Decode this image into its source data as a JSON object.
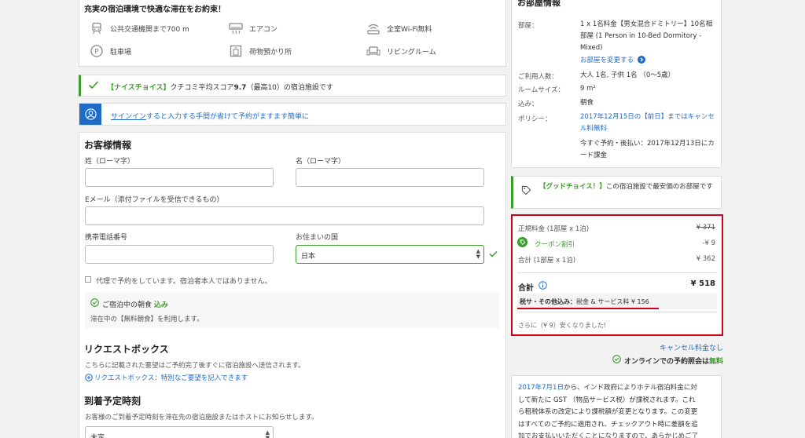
{
  "amenities": {
    "heading": "充実の宿泊環境で快適な滞在をお約束！",
    "items": [
      {
        "icon": "train-icon",
        "label": "公共交通機関まで700 m"
      },
      {
        "icon": "air-conditioner-icon",
        "label": "エアコン"
      },
      {
        "icon": "wifi-icon",
        "label": "全室Wi-Fi無料"
      },
      {
        "icon": "parking-icon",
        "label": "駐車場"
      },
      {
        "icon": "luggage-icon",
        "label": "荷物預かり所"
      },
      {
        "icon": "sofa-icon",
        "label": "リビングルーム"
      }
    ]
  },
  "nice_choice": {
    "tag": "【ナイスチョイス】",
    "text_before": "クチコミ平均スコア",
    "score": "9.7",
    "text_after": "（最高10）の宿泊施設です"
  },
  "signin": {
    "link": "サインイン",
    "text": "すると入力する手間が省けて予約がますます簡単に"
  },
  "guest_info": {
    "title": "お客様情報",
    "last_name_label": "姓（ローマ字）",
    "first_name_label": "名（ローマ字）",
    "email_label": "Eメール（添付ファイルを受信できるもの）",
    "phone_label": "携帯電話番号",
    "country_label": "お住まいの国",
    "country_value": "日本",
    "proxy_label": "代理で予約をしています。宿泊者本人ではありません。",
    "breakfast_title_prefix": "ご宿泊中の朝食",
    "breakfast_title_status": "込み",
    "breakfast_text": "滞在中の【無料朝食】を利用します。"
  },
  "request_box": {
    "title": "リクエストボックス",
    "desc": "こちらに記載された要望はご予約完了後すぐに宿泊施設へ送信されます。",
    "link": "リクエストボックス：特別なご要望を記入できます"
  },
  "arrival": {
    "title": "到着予定時刻",
    "desc": "お客様のご到着予定時刻を滞在先の宿泊施設またはホストにお知らせします。",
    "select_value": "未定"
  },
  "room_info": {
    "title": "お部屋情報",
    "room_label": "部屋：",
    "room_value": "1 x 1名料金【男女混合ドミトリー】10名相部屋 (1 Person in 10-Bed Dormitory - Mixed)",
    "change_link": "お部屋を変更する",
    "guests_label": "ご利用人数：",
    "guests_value": "大人 1名, 子供 1名 （0〜5歳）",
    "size_label": "ルームサイズ：",
    "size_value": "9 m²",
    "included_label": "込み：",
    "included_value": "朝食",
    "policy_label": "ポリシー：",
    "policy_value": "2017年12月15日の【前日】まではキャンセル料無料",
    "payment_value": "今すぐ予約・後払い：2017年12月13日にカード課金"
  },
  "good_choice": {
    "tag": "【グッドチョイス！】",
    "text": "この宿泊施設で最安価のお部屋です"
  },
  "price": {
    "regular_label": "正規料金 (1部屋 x 1泊)",
    "regular_value": "¥ 371",
    "coupon_label": "クーポン割引",
    "coupon_value": "-¥ 9",
    "subtotal_label": "合計 (1部屋 x 1泊)",
    "subtotal_value": "¥ 362",
    "total_label": "合計",
    "total_value": "¥ 518",
    "tax_label": "税サ・その他込み：",
    "tax_value": "税金 & サービス料 ¥ 156",
    "saving_text": "さらに（¥ 9）安くなりました!"
  },
  "no_cancel_fee": "キャンセル料金なし",
  "online_confirm": {
    "text": "オンラインでの予約照会は",
    "status": "無料"
  },
  "gst_notice": {
    "date": "2017年7月1日",
    "lines": [
      "から、インド政府によりホテル宿泊料金に対",
      "して新たに GST （物品サービス税）が課税されます。これ",
      "ら租税体系の改定により課税額が変更となります。この変更",
      "はすべてのご予約に適用され、チェックアウト時に差額を追",
      "加でお支払いいただくことになりますので、あらかじめご了"
    ]
  },
  "colors": {
    "accent_blue": "#1f6bc6",
    "success_green": "#3d9a2d",
    "highlight_red": "#d0021b"
  }
}
